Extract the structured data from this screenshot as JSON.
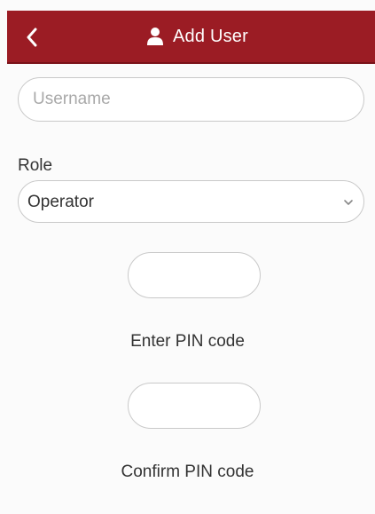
{
  "header": {
    "title": "Add User",
    "back_icon": "chevron-left-icon",
    "title_icon": "user-icon",
    "accent_color": "#9b1c24"
  },
  "form": {
    "username": {
      "value": "",
      "placeholder": "Username"
    },
    "role": {
      "label": "Role",
      "selected": "Operator"
    },
    "pin": {
      "enter_label": "Enter PIN code",
      "confirm_label": "Confirm PIN code",
      "enter_value": "",
      "confirm_value": ""
    }
  }
}
